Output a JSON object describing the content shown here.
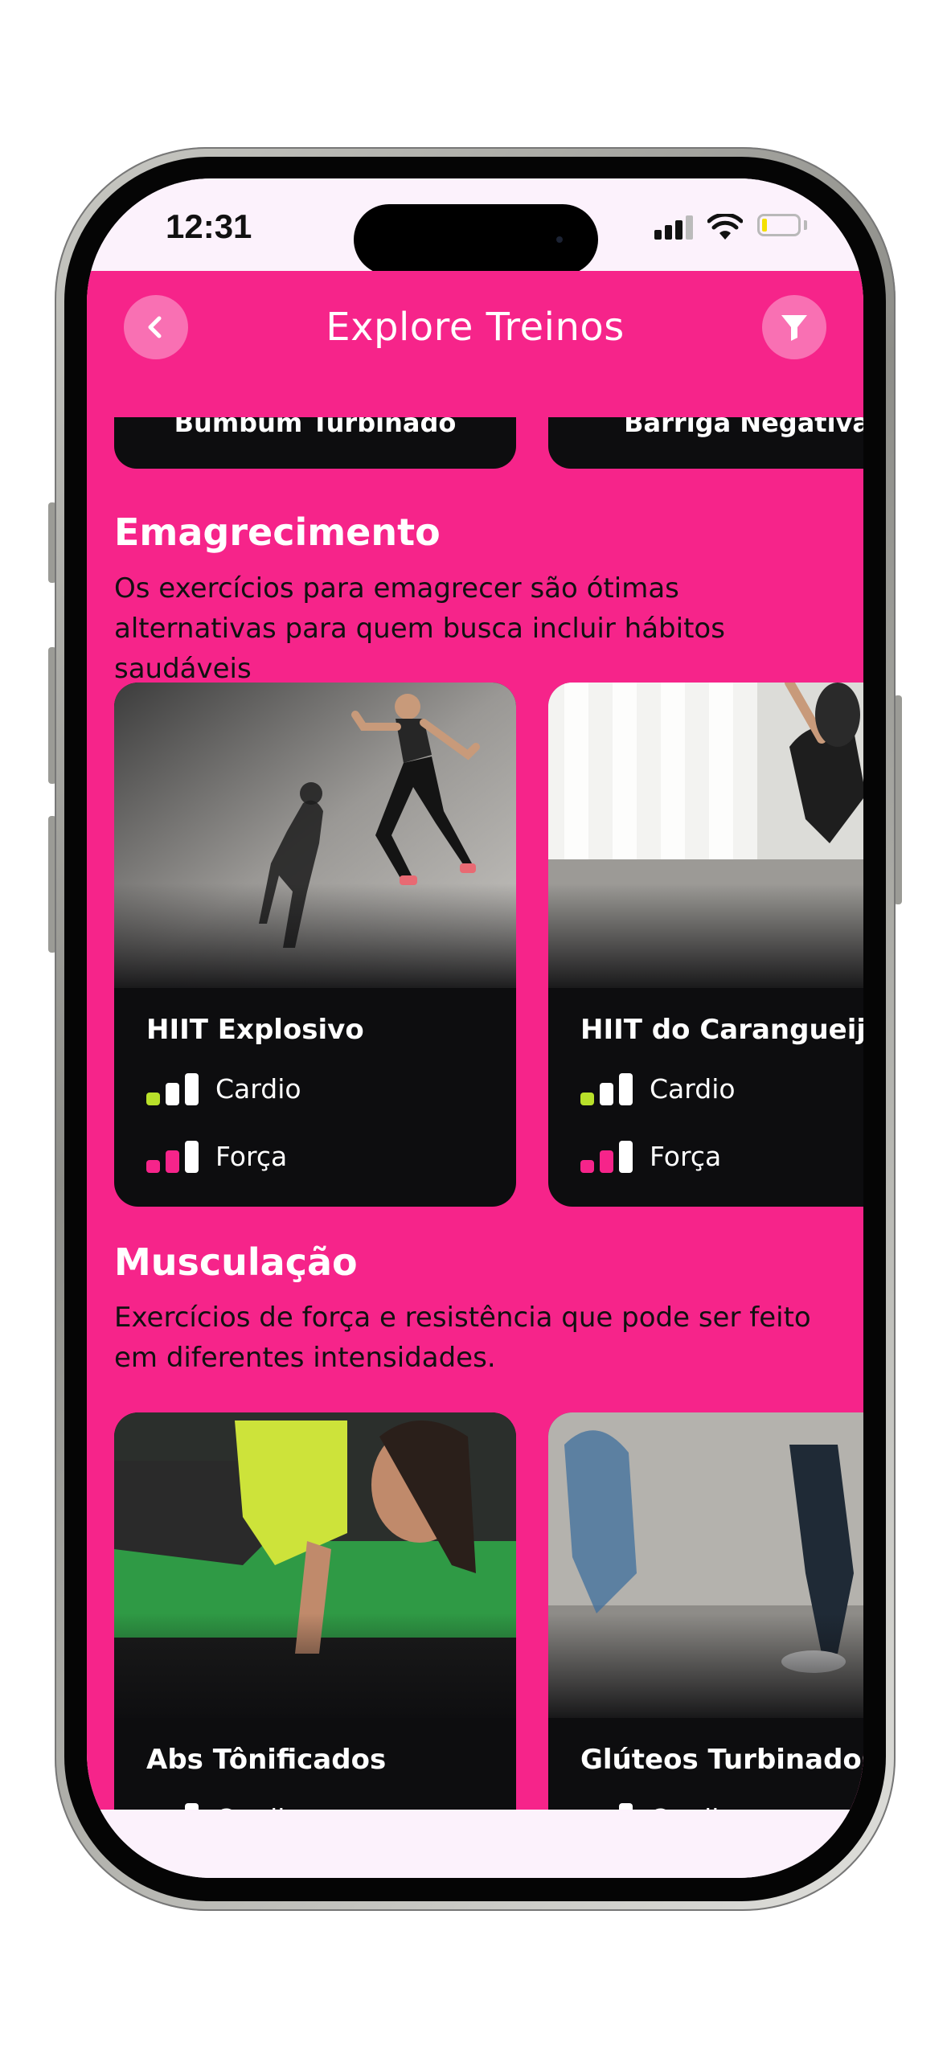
{
  "status": {
    "time": "12:31"
  },
  "header": {
    "title": "Explore Treinos"
  },
  "top_cards": [
    "Bumbum Turbinado",
    "Barriga Negativa"
  ],
  "sections": [
    {
      "title": "Emagrecimento",
      "description": "Os exercícios para emagrecer são ótimas alternativas para quem busca incluir hábitos saudáveis",
      "cards": [
        {
          "title": "HIIT Explosivo",
          "metrics": [
            {
              "label": "Cardio",
              "level": 1
            },
            {
              "label": "Força",
              "level": 2
            }
          ]
        },
        {
          "title": "HIIT do Carangueijo",
          "metrics": [
            {
              "label": "Cardio",
              "level": 1
            },
            {
              "label": "Força",
              "level": 2
            }
          ]
        }
      ]
    },
    {
      "title": "Musculação",
      "description": "Exercícios de força e resistência que pode ser feito em diferentes intensidades.",
      "cards": [
        {
          "title": "Abs Tônificados",
          "metrics": [
            {
              "label": "Cardio",
              "level": 1
            }
          ]
        },
        {
          "title": "Glúteos Turbinados",
          "metrics": [
            {
              "label": "Cardio",
              "level": 1
            }
          ]
        }
      ]
    }
  ],
  "colors": {
    "primary": "#f6248a",
    "card": "#0d0d0f",
    "cardio_active": "#b8e02a",
    "forca_active": "#f6248a",
    "bar_inactive": "#ffffff"
  },
  "icons": {
    "back": "chevron-left-icon",
    "filter": "filter-icon"
  }
}
